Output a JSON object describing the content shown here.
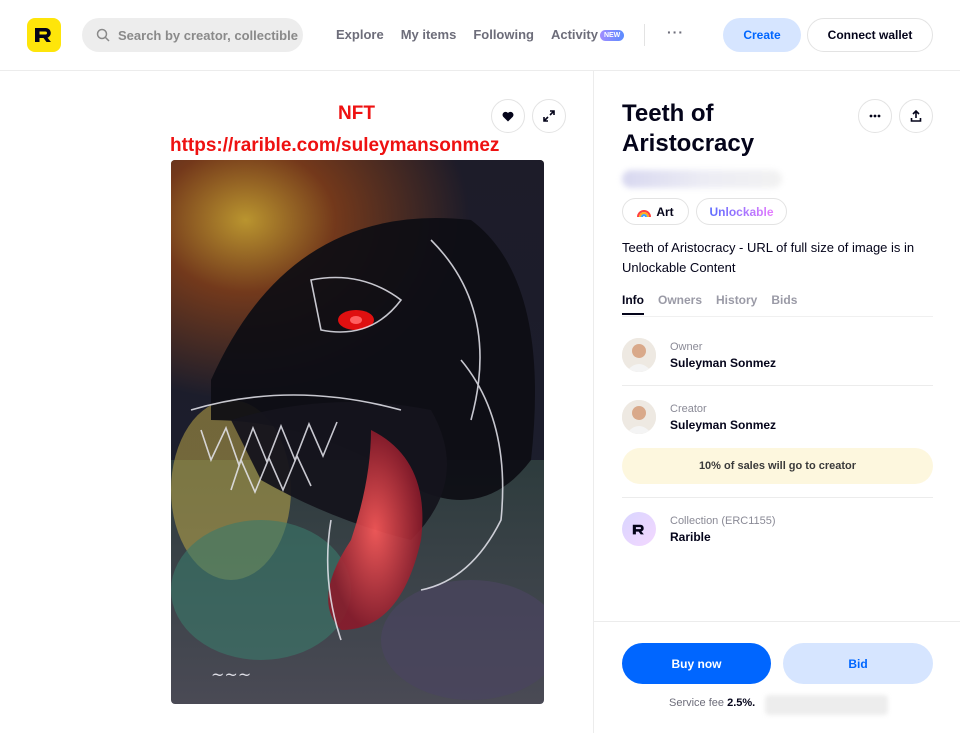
{
  "header": {
    "search_placeholder": "Search by creator, collectible",
    "nav": [
      {
        "label": "Explore"
      },
      {
        "label": "My items"
      },
      {
        "label": "Following"
      },
      {
        "label": "Activity"
      }
    ],
    "new_badge": "NEW",
    "more": "···",
    "create_label": "Create",
    "connect_label": "Connect wallet"
  },
  "artwork": {
    "caption": "NFT",
    "url_caption": "https://rarible.com/suleymansonmez"
  },
  "item": {
    "title": "Teeth of Aristocracy",
    "tags": [
      {
        "label": "Art",
        "icon": "rainbow-icon"
      },
      {
        "label": "Unlockable"
      }
    ],
    "description": "Teeth of Aristocracy - URL of full size of image is in Unlockable Content",
    "tabs": [
      "Info",
      "Owners",
      "History",
      "Bids"
    ],
    "owner": {
      "role": "Owner",
      "name": "Suleyman Sonmez"
    },
    "creator": {
      "role": "Creator",
      "name": "Suleyman Sonmez"
    },
    "royalty": "10% of sales will go to creator",
    "collection": {
      "role": "Collection (ERC1155)",
      "name": "Rarible"
    }
  },
  "actions": {
    "buy_label": "Buy now",
    "bid_label": "Bid",
    "fee_prefix": "Service fee",
    "fee_value": "2.5%."
  },
  "colors": {
    "brand_yellow": "#fee50a",
    "primary_blue": "#0066ff",
    "light_blue": "#d6e5ff",
    "caption_red": "#ee1111"
  }
}
